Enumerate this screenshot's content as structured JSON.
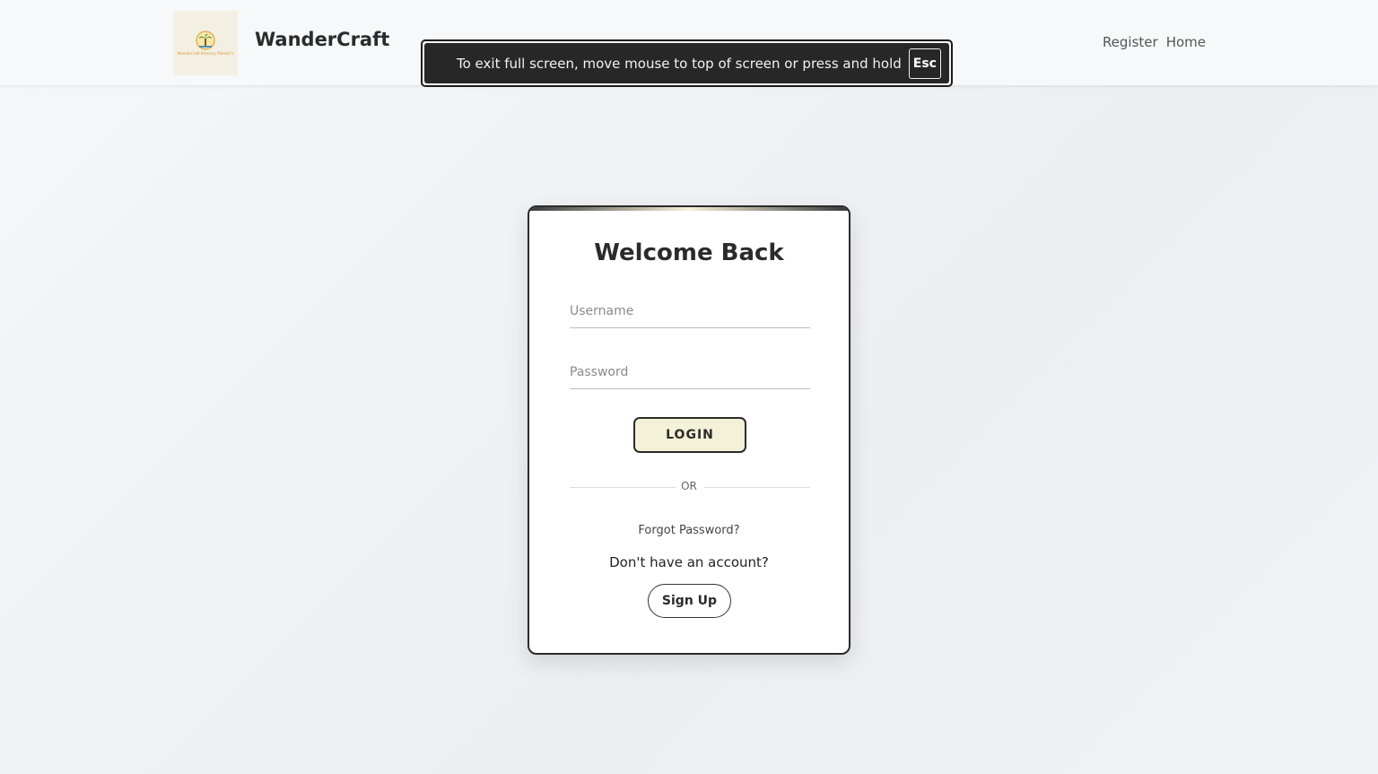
{
  "navbar": {
    "brand": "WanderCraft",
    "logo_text": "WanderCraft Itinerary Planner's",
    "links": [
      "Register",
      "Home"
    ]
  },
  "fullscreen_notice": {
    "message": "To exit full screen, move mouse to top of screen or press and hold",
    "key": "Esc"
  },
  "login": {
    "title": "Welcome Back",
    "username_placeholder": "Username",
    "password_placeholder": "Password",
    "login_label": "LOGIN",
    "divider": "OR",
    "forgot": "Forgot Password?",
    "no_account": "Don't have an account?",
    "signup_label": "Sign Up"
  },
  "colors": {
    "accent": "#f4f1d9",
    "text": "#2b2b2b",
    "banner": "#272727"
  }
}
